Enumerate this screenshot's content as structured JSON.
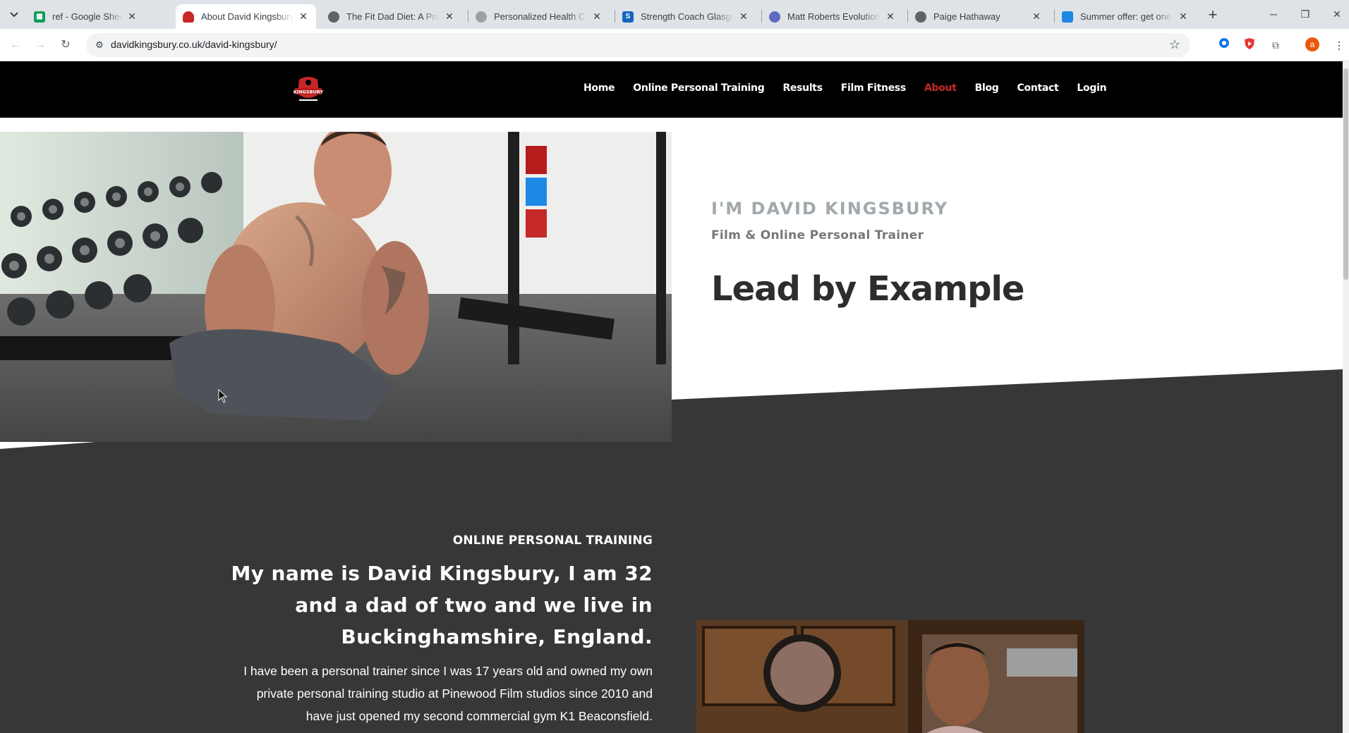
{
  "browser": {
    "tabs": [
      {
        "title": "ref - Google Sheets",
        "active": false
      },
      {
        "title": "About David Kingsbury | Online Personal Trainer",
        "active": true
      },
      {
        "title": "The Fit Dad Diet: A Proven",
        "active": false
      },
      {
        "title": "Personalized Health Coaching",
        "active": false
      },
      {
        "title": "Strength Coach Glasgow",
        "active": false
      },
      {
        "title": "Matt Roberts Evolution | ",
        "active": false
      },
      {
        "title": "Paige Hathaway",
        "active": false
      },
      {
        "title": "Summer offer: get one month",
        "active": false
      }
    ],
    "url": "davidkingsbury.co.uk/david-kingsbury/",
    "profile_initial": "a"
  },
  "site": {
    "menu": [
      {
        "label": "Home",
        "active": false
      },
      {
        "label": "Online Personal Training",
        "active": false
      },
      {
        "label": "Results",
        "active": false
      },
      {
        "label": "Film Fitness",
        "active": false
      },
      {
        "label": "About",
        "active": true
      },
      {
        "label": "Blog",
        "active": false
      },
      {
        "label": "Contact",
        "active": false
      },
      {
        "label": "Login",
        "active": false
      }
    ],
    "logo_text": "KINGSBURY",
    "accent_color": "#c62828"
  },
  "hero": {
    "kicker": "I'M DAVID KINGSBURY",
    "subtitle": "Film & Online Personal Trainer",
    "headline": "Lead by Example"
  },
  "about": {
    "kicker": "ONLINE PERSONAL TRAINING",
    "heading_lines": [
      "My name is David Kingsbury, I am 32",
      "and a dad of two and we live in",
      "Buckinghamshire, England."
    ],
    "body_lines": [
      "I have been a personal trainer since I was 17 years old and owned my own",
      "private personal training studio at Pinewood Film studios since 2010 and",
      "have just opened my second commercial gym K1 Beaconsfield."
    ]
  }
}
